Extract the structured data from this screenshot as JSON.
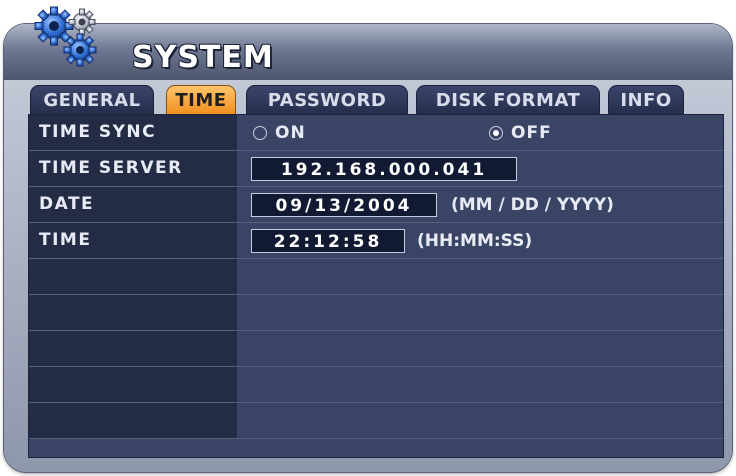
{
  "window": {
    "title": "SYSTEM"
  },
  "tabs": [
    {
      "label": "GENERAL",
      "active": false
    },
    {
      "label": "TIME",
      "active": true
    },
    {
      "label": "PASSWORD",
      "active": false
    },
    {
      "label": "DISK FORMAT",
      "active": false
    },
    {
      "label": "INFO",
      "active": false
    }
  ],
  "rows": {
    "time_sync": {
      "label": "TIME SYNC",
      "options": [
        {
          "label": "ON",
          "selected": false
        },
        {
          "label": "OFF",
          "selected": true
        }
      ]
    },
    "time_server": {
      "label": "TIME SERVER",
      "value": "192.168.000.041"
    },
    "date": {
      "label": "DATE",
      "value": "09/13/2004",
      "format": "(MM / DD / YYYY)"
    },
    "time": {
      "label": "TIME",
      "value": "22:12:58",
      "format": "(HH:MM:SS)"
    }
  },
  "colors": {
    "accent_tab": "#f08d1c",
    "panel": "#3a4566",
    "label_column": "#232b45"
  },
  "icons": {
    "title_icon": "gears-icon"
  }
}
